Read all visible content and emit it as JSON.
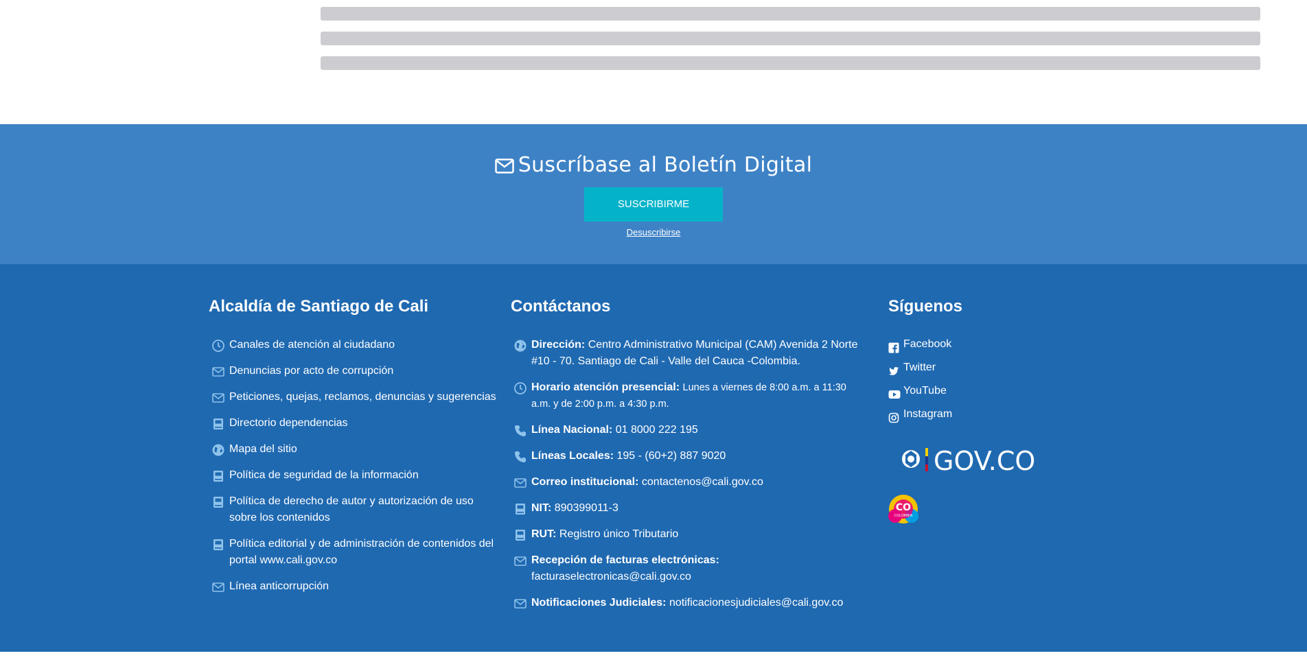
{
  "newsletter": {
    "title": "Suscríbase al Boletín Digital",
    "subscribe_label": "SUSCRIBIRME",
    "unsubscribe_label": "Desuscribirse"
  },
  "footer": {
    "col1": {
      "title": "Alcaldía de Santiago de Cali",
      "items": [
        {
          "label": "Canales de atención al ciudadano",
          "icon": "clock-icon"
        },
        {
          "label": "Denuncias por acto de corrupción",
          "icon": "envelope-icon"
        },
        {
          "label": "Peticiones, quejas, reclamos, denuncias y sugerencias",
          "icon": "envelope-icon"
        },
        {
          "label": "Directorio dependencias",
          "icon": "book-icon"
        },
        {
          "label": "Mapa del sitio",
          "icon": "globe-icon"
        },
        {
          "label": "Política de seguridad de la información",
          "icon": "book-icon"
        },
        {
          "label": "Política de derecho de autor y autorización de uso sobre los contenidos",
          "icon": "book-icon"
        },
        {
          "label": "Política editorial y de administración de contenidos del portal www.cali.gov.co",
          "icon": "book-icon"
        },
        {
          "label": "Línea anticorrupción",
          "icon": "envelope-icon"
        }
      ]
    },
    "col2": {
      "title": "Contáctanos",
      "items": [
        {
          "key": "Dirección:",
          "value": "Centro Administrativo Municipal (CAM) Avenida 2 Norte #10 - 70. Santiago de Cali - Valle del Cauca -Colombia.",
          "icon": "globe-icon"
        },
        {
          "key": "Horario atención presencial:",
          "value": "Lunes a viernes de 8:00 a.m. a 11:30 a.m. y de 2:00 p.m. a 4:30 p.m.",
          "icon": "clock-icon"
        },
        {
          "key": "Línea Nacional:",
          "value": "01 8000 222 195",
          "icon": "phone-icon"
        },
        {
          "key": "Líneas Locales:",
          "value": "195 - (60+2) 887 9020",
          "icon": "phone-icon"
        },
        {
          "key": "Correo institucional:",
          "value": "contactenos@cali.gov.co",
          "icon": "envelope-icon"
        },
        {
          "key": "NIT:",
          "value": "890399011-3",
          "icon": "book-icon"
        },
        {
          "key": "RUT:",
          "value": "Registro único Tributario",
          "icon": "book-icon"
        },
        {
          "key": "Recepción de facturas electrónicas:",
          "value": "facturaselectronicas@cali.gov.co",
          "icon": "envelope-icon"
        },
        {
          "key": "Notificaciones Judiciales:",
          "value": "notificacionesjudiciales@cali.gov.co",
          "icon": "envelope-icon"
        }
      ]
    },
    "col3": {
      "title": "Síguenos",
      "social": [
        {
          "label": "Facebook",
          "icon": "facebook-icon"
        },
        {
          "label": "Twitter",
          "icon": "twitter-icon"
        },
        {
          "label": "YouTube",
          "icon": "youtube-icon"
        },
        {
          "label": "Instagram",
          "icon": "instagram-icon"
        }
      ],
      "govco_label": "GOV.CO",
      "colombia_badge": "CO",
      "colombia_badge_sub": "COLOMBIA"
    }
  },
  "colors": {
    "newsletter_bg": "#3e82c6",
    "footer_bg": "#1f69b1",
    "button_bg": "#05b3c9",
    "icon_color": "#8fc3ec",
    "skeleton": "#cdcdd1"
  }
}
